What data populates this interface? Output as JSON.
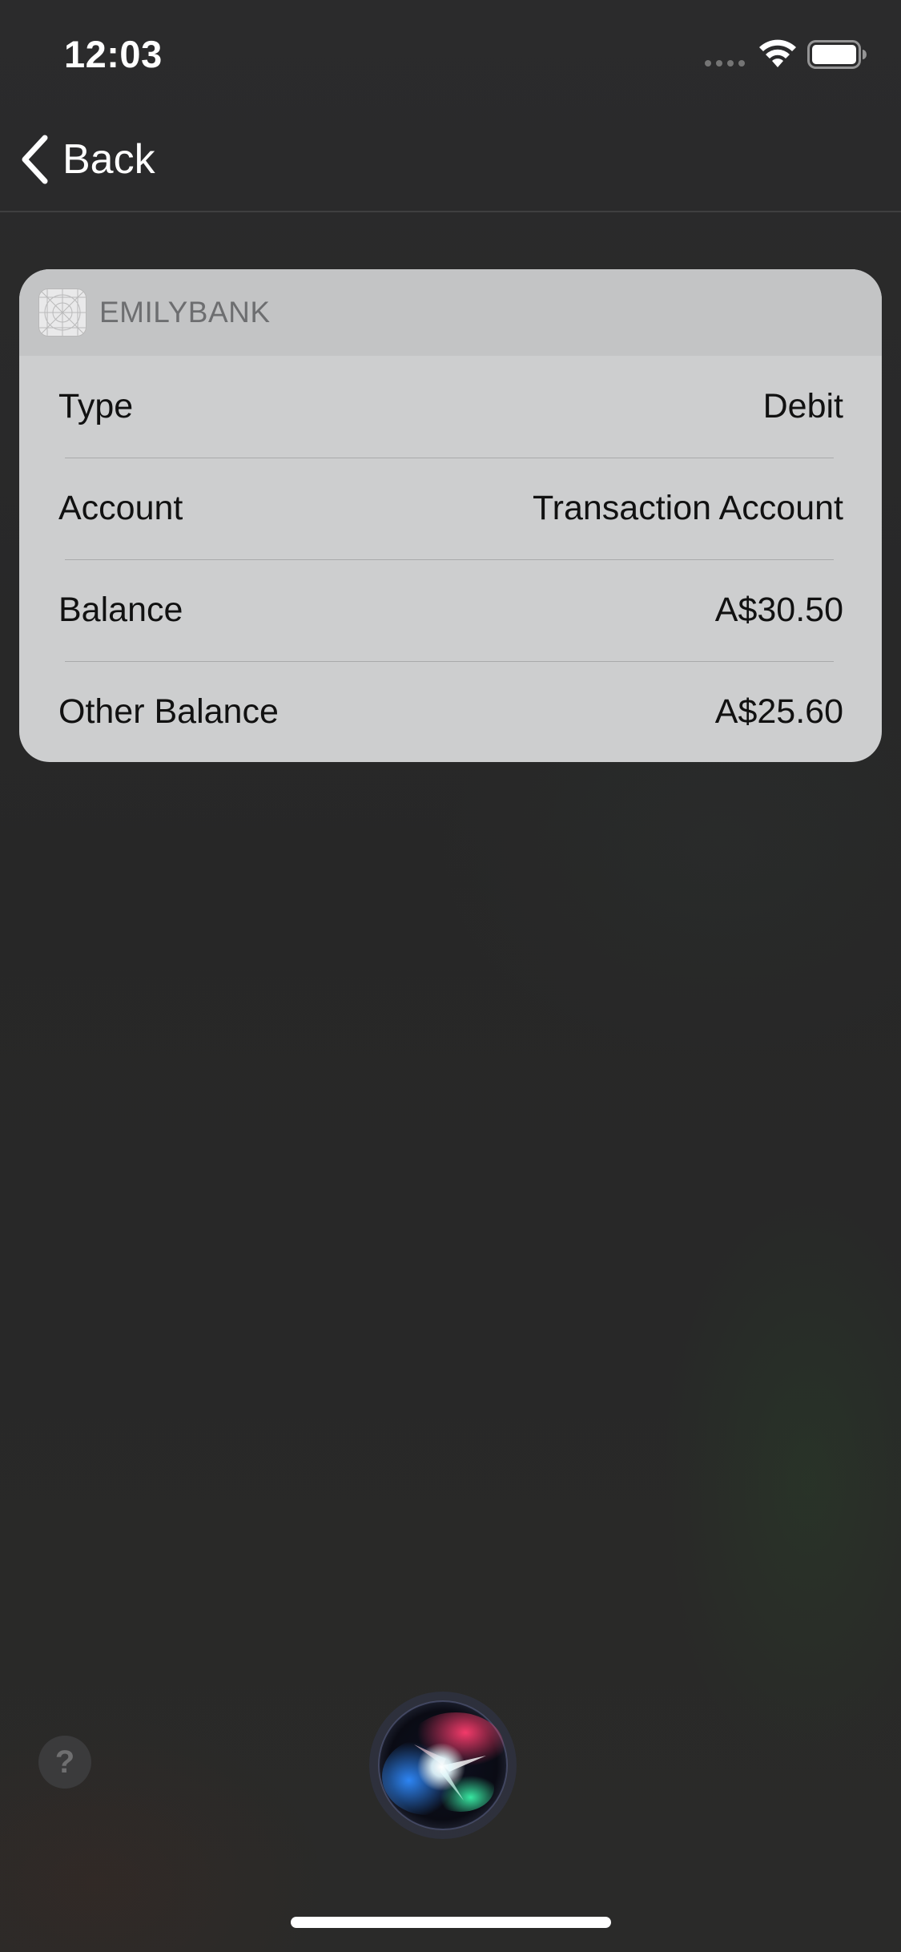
{
  "status_bar": {
    "time": "12:03"
  },
  "nav": {
    "back_label": "Back"
  },
  "card": {
    "app_name": "EMILYBANK",
    "rows": [
      {
        "label": "Type",
        "value": "Debit"
      },
      {
        "label": "Account",
        "value": "Transaction Account"
      },
      {
        "label": "Balance",
        "value": "A$30.50"
      },
      {
        "label": "Other Balance",
        "value": "A$25.60"
      }
    ]
  },
  "help": {
    "symbol": "?"
  },
  "colors": {
    "background": "#2a2a2b",
    "card": "#cdcecf",
    "card_header": "#c3c4c5",
    "text_dark": "#111111",
    "app_name": "#6d6e70"
  },
  "icons": {
    "back": "chevron-left-icon",
    "wifi": "wifi-icon",
    "battery": "battery-icon",
    "signal": "signal-dots-icon",
    "app": "app-placeholder-icon",
    "siri": "siri-orb-icon"
  }
}
